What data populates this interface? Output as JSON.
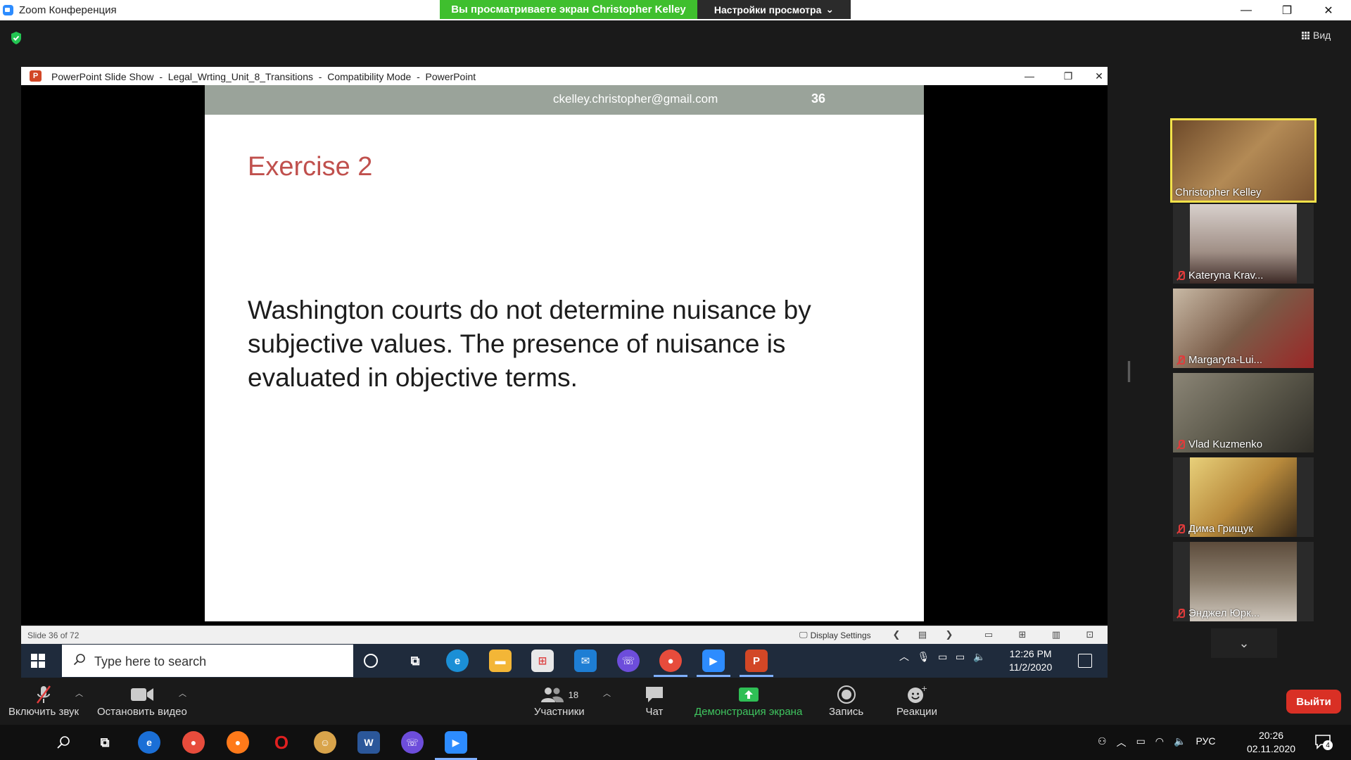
{
  "zoom": {
    "window_title": "Zoom Конференция",
    "share_banner": "Вы просматриваете экран Christopher Kelley",
    "view_settings_label": "Настройки просмотра",
    "view_label": "Вид",
    "leave_label": "Выйти"
  },
  "ppt": {
    "title_app": "PowerPoint Slide Show",
    "title_file": "Legal_Wrting_Unit_8_Transitions",
    "title_mode": "Compatibility Mode",
    "title_product": "PowerPoint",
    "title_sep": "-",
    "slide_counter": "Slide 36 of 72",
    "display_settings": "Display Settings"
  },
  "slide": {
    "email": "ckelley.christopher@gmail.com",
    "number": "36",
    "title": "Exercise 2",
    "body": "Washington courts do not determine nuisance by subjective values.  The presence of nuisance is evaluated in objective terms."
  },
  "inner_taskbar": {
    "search_placeholder": "Type here to search",
    "time": "12:26 PM",
    "date": "11/2/2020"
  },
  "participants": [
    {
      "name": "Christopher Kelley",
      "muted": false,
      "active": true,
      "color": "#8a5a34"
    },
    {
      "name": "Kateryna Krav...",
      "muted": true,
      "active": false,
      "color": "#a08f86"
    },
    {
      "name": "Margaryta-Lui...",
      "muted": true,
      "active": false,
      "color": "#7a5c48"
    },
    {
      "name": "Vlad Kuzmenko",
      "muted": true,
      "active": false,
      "color": "#5d5a4c"
    },
    {
      "name": "Дима Грищук",
      "muted": true,
      "active": false,
      "color": "#b88a3c"
    },
    {
      "name": "Энджел Юрк...",
      "muted": true,
      "active": false,
      "color": "#8d806f"
    }
  ],
  "toolbar": {
    "unmute": "Включить звук",
    "stop_video": "Остановить видео",
    "participants": "Участники",
    "participants_count": "18",
    "chat": "Чат",
    "share_screen": "Демонстрация экрана",
    "record": "Запись",
    "reactions": "Реакции"
  },
  "outer_taskbar": {
    "lang": "РУС",
    "time": "20:26",
    "date": "02.11.2020",
    "notifications": "4"
  },
  "colors": {
    "share_green": "#3fbf2e",
    "slide_title": "#c0504d",
    "slide_header": "#9aa39a",
    "leave_red": "#d93025",
    "active_speaker": "#f2e24a"
  }
}
